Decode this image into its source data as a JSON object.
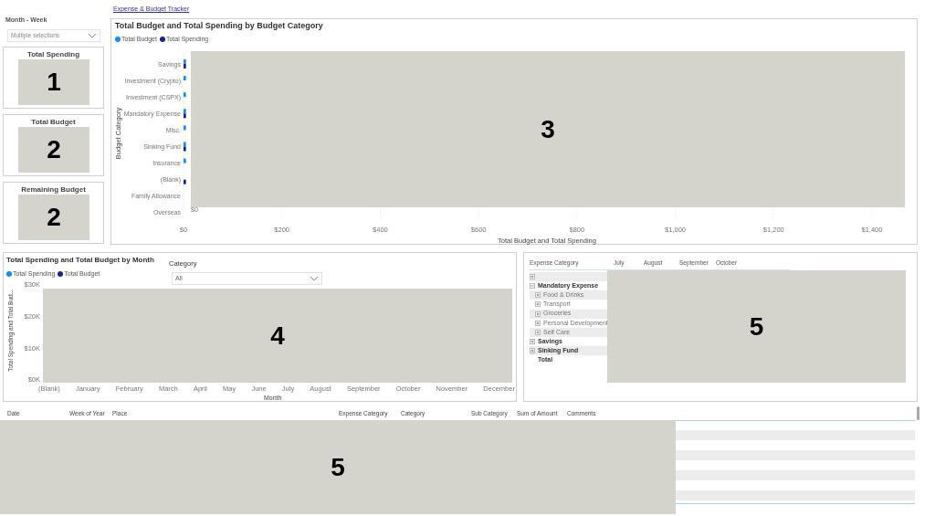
{
  "page_link": "Expense & Budget Tracker",
  "slicer": {
    "label": "Month - Week",
    "value": "Multiple selections"
  },
  "cards": [
    {
      "title": "Total Spending",
      "redaction": "1"
    },
    {
      "title": "Total Budget",
      "redaction": "2"
    },
    {
      "title": "Remaining Budget",
      "redaction": "2"
    }
  ],
  "bar_chart": {
    "redaction": "3",
    "chart_data": {
      "type": "bar",
      "orientation": "horizontal",
      "title": "Total Budget and Total Spending by Budget Category",
      "xlabel": "Total Budget and Total Spending",
      "ylabel": "Budget Category",
      "categories": [
        "Savings",
        "Investment (Crypto)",
        "Investment (CSPX)",
        "Mandatory Expense",
        "Misc.",
        "Sinking Fund",
        "Insurance",
        "(Blank)",
        "Family Allowance",
        "Overseas"
      ],
      "series": [
        {
          "name": "Total Budget",
          "color": "#118dff",
          "values": [
            5,
            5,
            5,
            5,
            5,
            5,
            5,
            null,
            null,
            null
          ]
        },
        {
          "name": "Total Spending",
          "color": "#12239e",
          "values": [
            5,
            null,
            null,
            5,
            null,
            5,
            null,
            5,
            null,
            null
          ]
        }
      ],
      "xticks": [
        {
          "value": 0,
          "label": "$0"
        },
        {
          "value": 200,
          "label": "$200"
        },
        {
          "value": 400,
          "label": "$400"
        },
        {
          "value": 600,
          "label": "$600"
        },
        {
          "value": 800,
          "label": "$800"
        },
        {
          "value": 1000,
          "label": "$1,000"
        },
        {
          "value": 1200,
          "label": "$1,200"
        },
        {
          "value": 1400,
          "label": "$1,400"
        }
      ],
      "xlim": [
        0,
        1400
      ],
      "grid": true,
      "annotations": [
        "$0"
      ]
    }
  },
  "month_chart": {
    "title": "Total Spending and Total Budget by Month",
    "redaction": "4",
    "legend": [
      {
        "name": "Total Spending",
        "color": "#118dff"
      },
      {
        "name": "Total Budget",
        "color": "#12239e"
      }
    ],
    "ylabel": "Total Spending and Total Bud...",
    "xlabel": "Month",
    "yticks": [
      "$30K",
      "$20K",
      "$10K",
      "$0K"
    ],
    "categories": [
      "(Blank)",
      "January",
      "February",
      "March",
      "April",
      "May",
      "June",
      "July",
      "August",
      "September",
      "October",
      "November",
      "December"
    ],
    "filter": {
      "label": "Category",
      "value": "All"
    }
  },
  "matrix": {
    "redaction": "5",
    "columns": [
      "Expense Category",
      "July",
      "August",
      "September",
      "October"
    ],
    "rows": [
      {
        "expanded": false
      },
      {
        "label": "Mandatory Expense",
        "expanded": true,
        "children": [
          {
            "label": "Food & Drinks",
            "expanded": false
          },
          {
            "label": "Transport",
            "expanded": false
          },
          {
            "label": "Groceries",
            "expanded": false
          },
          {
            "label": "Personal Development",
            "expanded": false
          },
          {
            "label": "Self Care",
            "expanded": false
          }
        ]
      },
      {
        "label": "Savings",
        "expanded": false
      },
      {
        "label": "Sinking Fund",
        "expanded": false
      }
    ],
    "total": "Total"
  },
  "table": {
    "redaction": "5",
    "columns": [
      "Date",
      "Week of Year",
      "Place",
      "Expense Category",
      "Category",
      "Sub Category",
      "Sum of Amount",
      "Comments"
    ]
  }
}
